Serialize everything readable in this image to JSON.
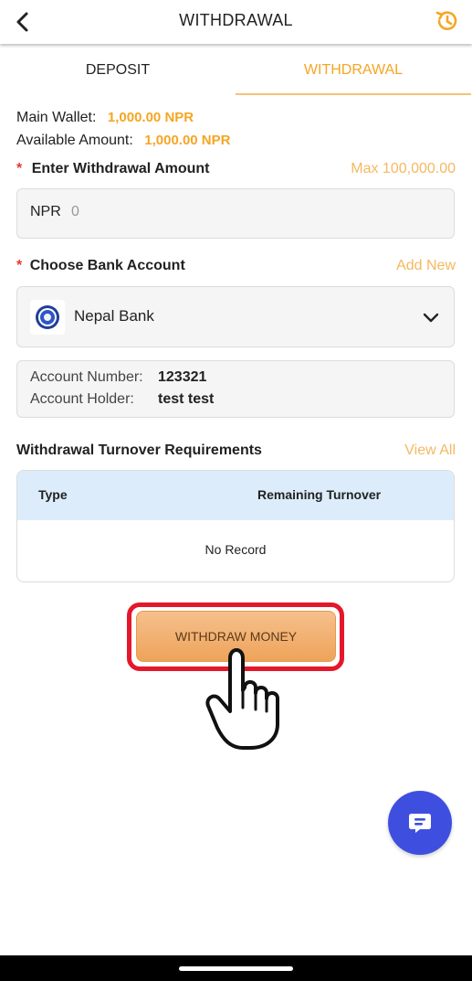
{
  "header": {
    "title": "WITHDRAWAL",
    "back_icon": "chevron-left-icon",
    "history_icon": "history-icon"
  },
  "tabs": [
    {
      "label": "DEPOSIT"
    },
    {
      "label": "WITHDRAWAL",
      "active": true
    }
  ],
  "wallet": {
    "main_label": "Main Wallet:",
    "main_value": "1,000.00 NPR",
    "available_label": "Available Amount:",
    "available_value": "1,000.00 NPR"
  },
  "amount": {
    "required_mark": "*",
    "label": "Enter Withdrawal Amount",
    "max": "Max 100,000.00",
    "currency": "NPR",
    "placeholder": "0"
  },
  "bank": {
    "required_mark": "*",
    "label": "Choose Bank Account",
    "add_new": "Add New",
    "selected": "Nepal Bank",
    "account_number_label": "Account Number:",
    "account_number": "123321",
    "account_holder_label": "Account Holder:",
    "account_holder": "test test"
  },
  "turnover": {
    "title": "Withdrawal Turnover Requirements",
    "view_all": "View All",
    "columns": [
      "Type",
      "Remaining Turnover"
    ],
    "empty": "No Record"
  },
  "submit": {
    "label": "WITHDRAW MONEY"
  },
  "colors": {
    "accent": "#f5a623",
    "button": "#f2b377",
    "highlight": "#e4172b",
    "fab": "#3e4fe0",
    "table_header": "#dcecfb"
  }
}
